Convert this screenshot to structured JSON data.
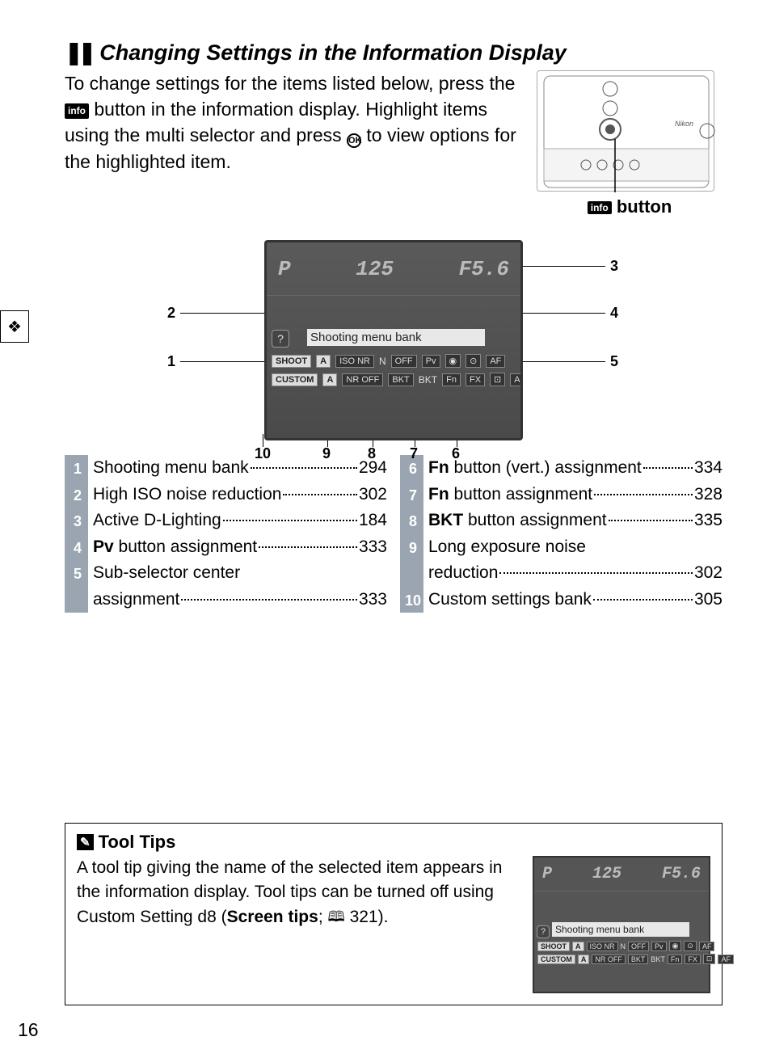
{
  "sectionTitle": "Changing Settings in the Information Display",
  "intro": {
    "part1": "To change settings for the items listed below, press the ",
    "part2": " button in the information display. Highlight items using the multi selector and press ",
    "part3": " to view options for the highlighted item."
  },
  "infoIconText": "info",
  "okIconText": "OK",
  "buttonLabel": "button",
  "lcd": {
    "p": "P",
    "shutter": "125",
    "aperture": "F5.6",
    "label": "Shooting menu bank",
    "help": "?",
    "row1": {
      "shoot": "SHOOT",
      "a": "A",
      "iso": "ISO NR",
      "n": "N",
      "off": "OFF",
      "pv": "Pv",
      "fn": "◉",
      "dot": "⊙",
      "af": "AF"
    },
    "row2": {
      "custom": "CUSTOM",
      "a": "A",
      "nroff": "NR OFF",
      "bkt1": "BKT",
      "bkt2": "BKT",
      "fn": "Fn",
      "fx": "FX",
      "g": "⊡",
      "af": "AF"
    }
  },
  "callouts": {
    "c1": "1",
    "c2": "2",
    "c3": "3",
    "c4": "4",
    "c5": "5",
    "c6": "6",
    "c7": "7",
    "c8": "8",
    "c9": "9",
    "c10": "10"
  },
  "listLeft": [
    {
      "num": "1",
      "text": "Shooting menu bank",
      "page": "294"
    },
    {
      "num": "2",
      "text": "High ISO noise reduction ",
      "page": "302"
    },
    {
      "num": "3",
      "text": "Active D-Lighting ",
      "page": "184"
    },
    {
      "num": "4",
      "prefix": "Pv",
      "text": " button assignment ",
      "page": "333"
    },
    {
      "num": "5",
      "line1": "Sub-selector center",
      "text": "assignment ",
      "page": "333"
    }
  ],
  "listRight": [
    {
      "num": "6",
      "prefix": "Fn",
      "text": " button (vert.) assignment ",
      "page": "334"
    },
    {
      "num": "7",
      "prefix": "Fn",
      "text": " button assignment ",
      "page": "328"
    },
    {
      "num": "8",
      "prefix": "BKT",
      "text": " button assignment",
      "page": "335"
    },
    {
      "num": "9",
      "line1": "Long exposure noise",
      "text": "reduction",
      "page": "302"
    },
    {
      "num": "10",
      "text": "Custom settings bank ",
      "page": "305"
    }
  ],
  "tips": {
    "title": "Tool Tips",
    "body1": "A tool tip giving the name of the selected item appears in the information display. Tool tips can be turned off using Custom Setting d8 (",
    "bold1": "Screen tips",
    "body2": "; ",
    "pageRef": "321",
    "body3": ")."
  },
  "pageNumber": "16"
}
